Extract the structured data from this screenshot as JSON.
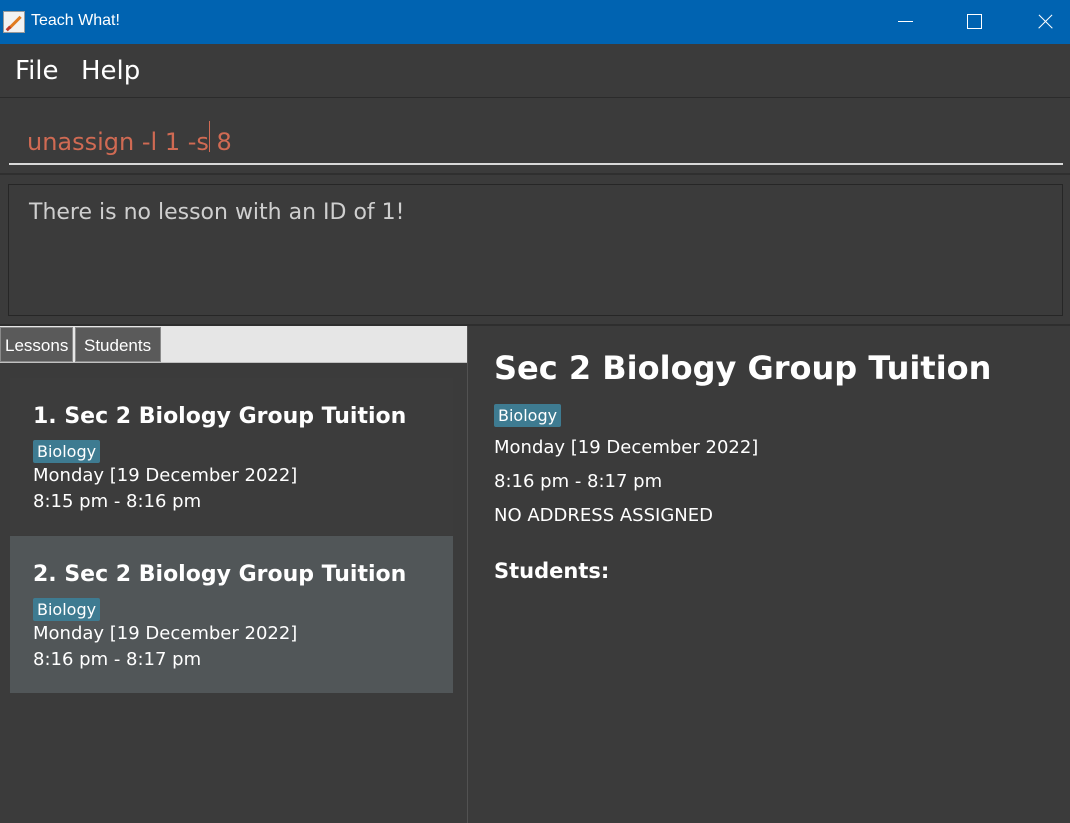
{
  "window": {
    "title": "Teach What!",
    "icon": "notepad-pencil-icon"
  },
  "menu": {
    "items": [
      "File",
      "Help"
    ]
  },
  "command": {
    "value": "unassign -l 1 -s 8"
  },
  "result": {
    "message": "There is no lesson with an ID of 1!"
  },
  "tabs": [
    "Lessons",
    "Students"
  ],
  "lessons": [
    {
      "title": "1.  Sec 2 Biology Group Tuition",
      "tag": "Biology",
      "date": "Monday [19 December 2022]",
      "time": "8:15 pm - 8:16 pm",
      "selected": false
    },
    {
      "title": "2.  Sec 2 Biology Group Tuition",
      "tag": "Biology",
      "date": "Monday [19 December 2022]",
      "time": "8:16 pm - 8:17 pm",
      "selected": true
    }
  ],
  "detail": {
    "title": "Sec 2 Biology Group Tuition",
    "tag": "Biology",
    "date": "Monday [19 December 2022]",
    "time": "8:16 pm - 8:17 pm",
    "address": "NO ADDRESS ASSIGNED",
    "students_label": "Students:"
  },
  "colors": {
    "titlebar": "#0063b1",
    "background": "#3b3b3b",
    "selected_card": "#515658",
    "tag": "#3e7b91",
    "command_text": "#d06a53"
  }
}
